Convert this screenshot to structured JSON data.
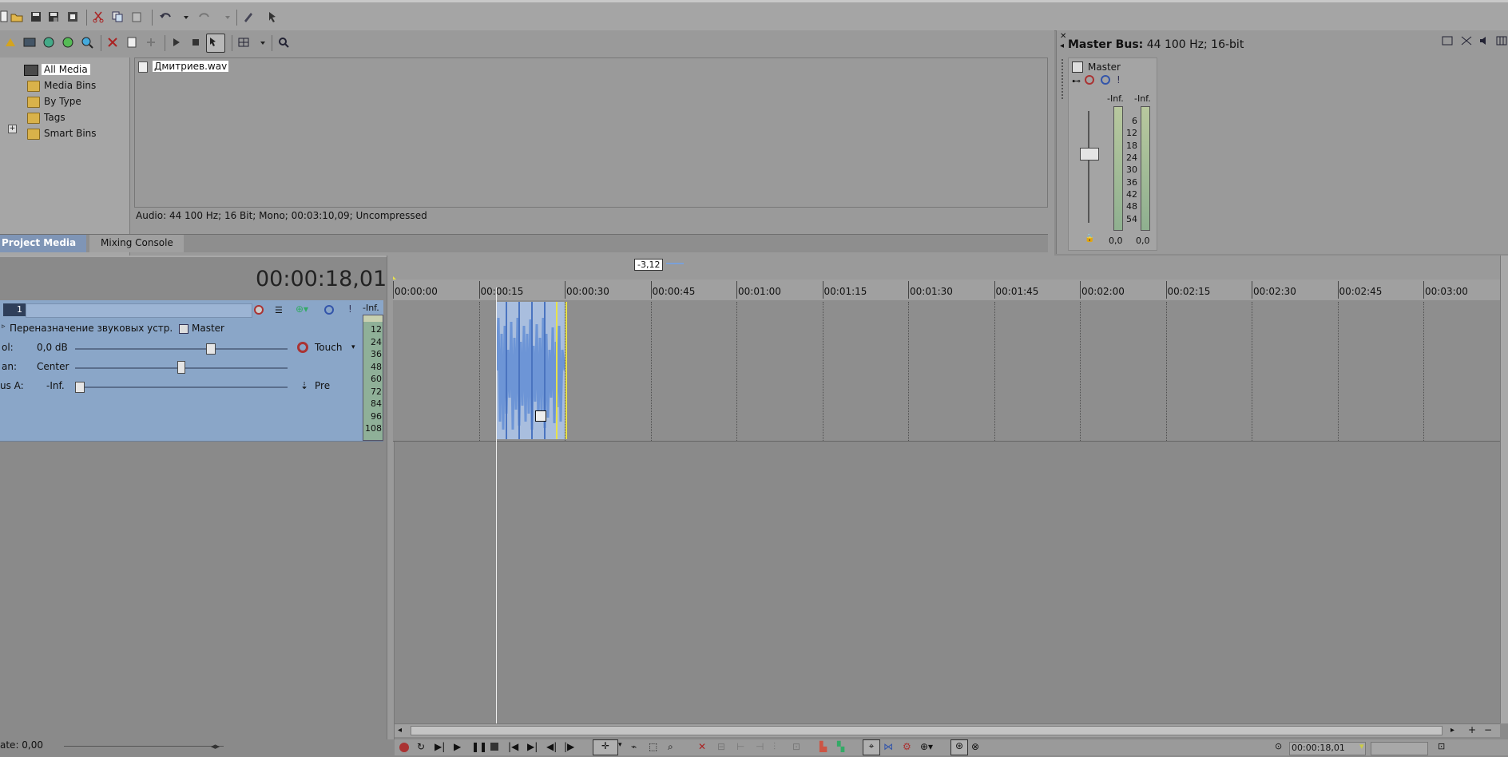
{
  "media_tree": {
    "items": [
      {
        "label": "All Media",
        "selected": true
      },
      {
        "label": "Media Bins"
      },
      {
        "label": "By Type"
      },
      {
        "label": "Tags"
      },
      {
        "label": "Smart Bins"
      }
    ]
  },
  "media_files": {
    "file_name": "Дмитриев.wav",
    "info": "Audio: 44 100 Hz; 16 Bit; Mono; 00:03:10,09; Uncompressed"
  },
  "window_tabs": {
    "project_media": "Project Media",
    "mixing_console": "Mixing Console"
  },
  "master_bus": {
    "title": "Master Bus:",
    "format": "44 100 Hz; 16-bit",
    "channel_name": "Master",
    "peak_left": "-Inf.",
    "peak_right": "-Inf.",
    "scale": [
      "6",
      "12",
      "18",
      "24",
      "30",
      "36",
      "42",
      "48",
      "54"
    ],
    "level_left": "0,0",
    "level_right": "0,0"
  },
  "timeline": {
    "time_display": "00:00:18,01",
    "marker_value": "-3,12",
    "ruler": [
      "00:00:00",
      "00:00:15",
      "00:00:30",
      "00:00:45",
      "00:01:00",
      "00:01:15",
      "00:01:30",
      "00:01:45",
      "00:02:00",
      "00:02:15",
      "00:02:30",
      "00:02:45",
      "00:03:00"
    ],
    "status_time": "00:00:18,01",
    "rate": "ate: 0,00"
  },
  "track": {
    "number": "1",
    "peak": "-Inf.",
    "routing_label": "Переназначение звуковых устр.",
    "output": "Master",
    "vol_label": "ol:",
    "vol_value": "0,0 dB",
    "vol_level": 0.64,
    "pan_label": "an:",
    "pan_value": "Center",
    "pan_level": 0.5,
    "bus_label": "us A:",
    "bus_value": "-Inf.",
    "bus_level": 0.0,
    "automation_mode": "Touch",
    "bus_mode": "Pre",
    "meter_scale": [
      "12",
      "24",
      "36",
      "48",
      "60",
      "72",
      "84",
      "96",
      "108"
    ]
  },
  "colors": {
    "track_header": "#8aa6c8",
    "clip_wave": "#6d95d6",
    "accent_yellow": "#e7e24a"
  }
}
